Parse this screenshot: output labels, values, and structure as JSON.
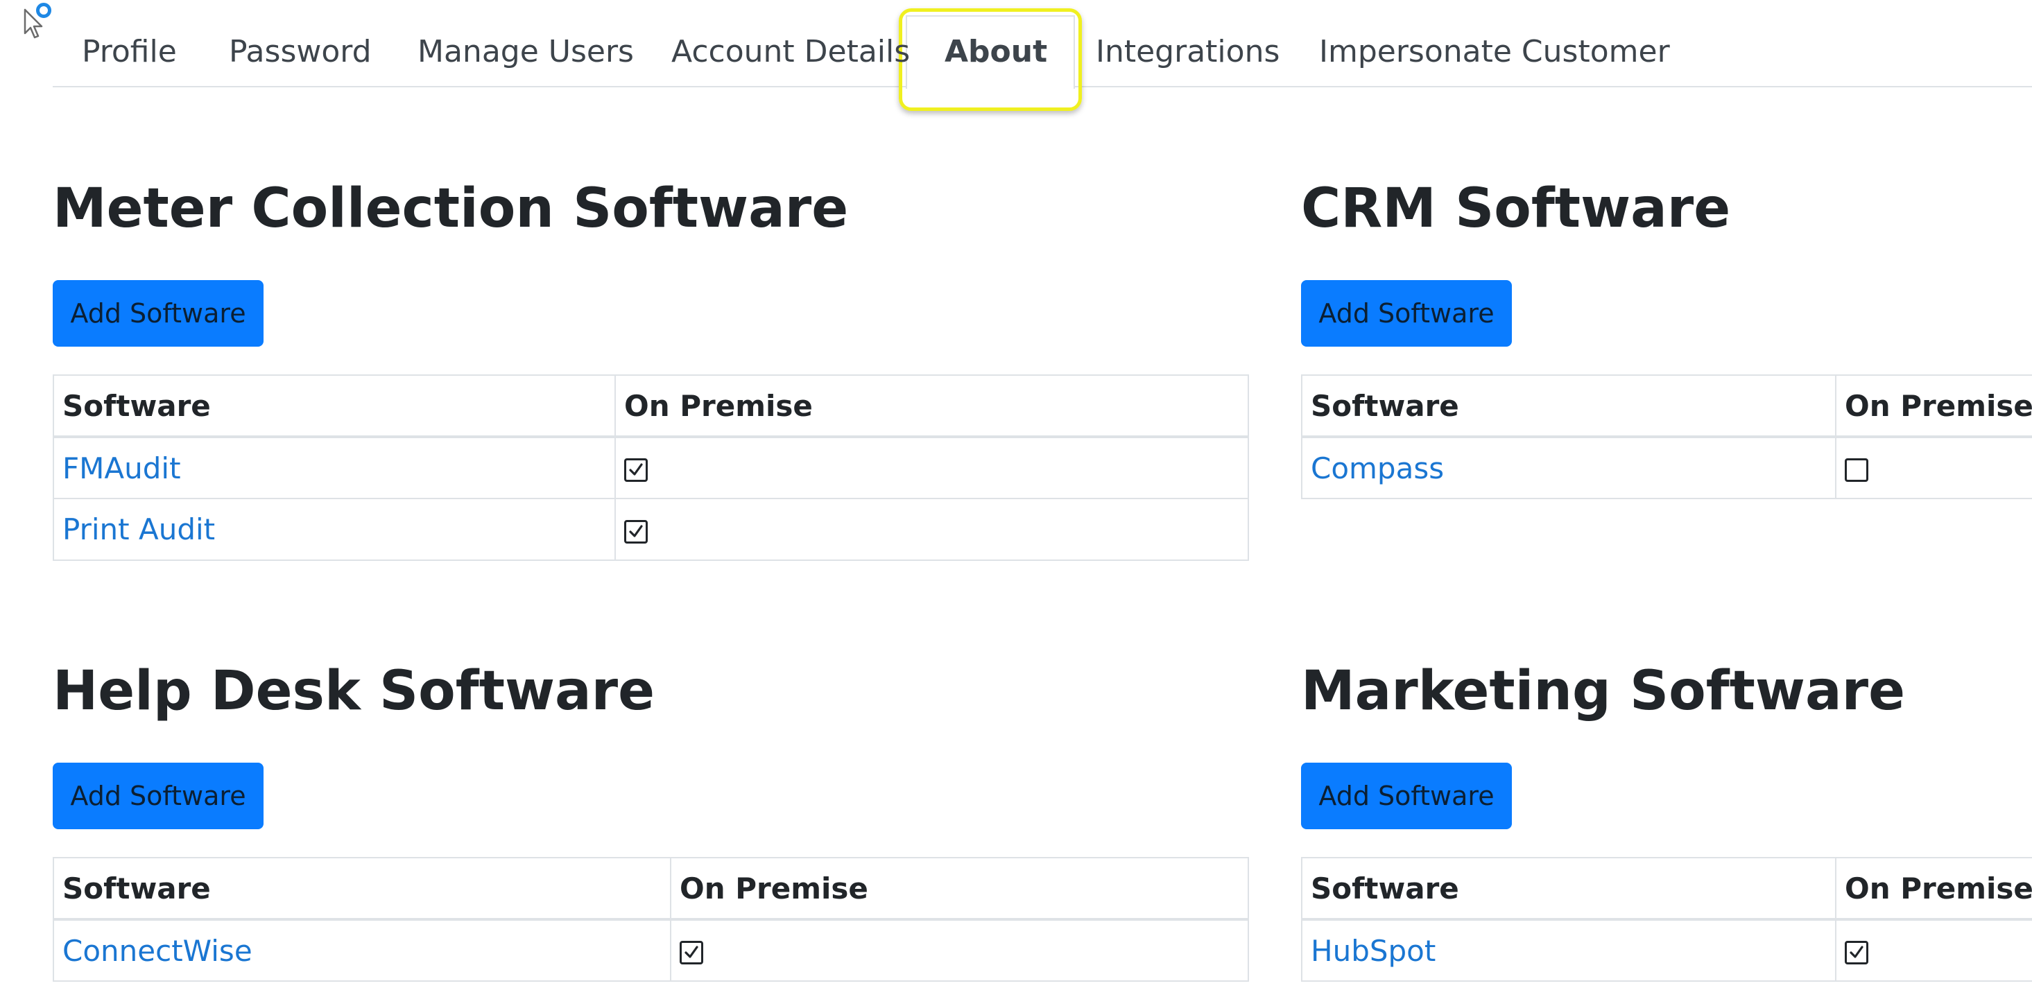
{
  "tabs": [
    {
      "label": "Profile",
      "active": false
    },
    {
      "label": "Password",
      "active": false
    },
    {
      "label": "Manage Users",
      "active": false
    },
    {
      "label": "Account Details",
      "active": false
    },
    {
      "label": "About",
      "active": true
    },
    {
      "label": "Integrations",
      "active": false
    },
    {
      "label": "Impersonate Customer",
      "active": false
    }
  ],
  "colors": {
    "primary_button": "#0a7cff",
    "link": "#1a76d2",
    "highlight": "#f0f020"
  },
  "sections": {
    "meter": {
      "title": "Meter Collection Software",
      "add_label": "Add Software",
      "col_software": "Software",
      "col_on_premise": "On Premise",
      "rows": [
        {
          "name": "FMAudit",
          "on_premise": true
        },
        {
          "name": "Print Audit",
          "on_premise": true
        }
      ]
    },
    "crm": {
      "title": "CRM Software",
      "add_label": "Add Software",
      "col_software": "Software",
      "col_on_premise": "On Premise",
      "rows": [
        {
          "name": "Compass",
          "on_premise": false
        }
      ]
    },
    "helpdesk": {
      "title": "Help Desk Software",
      "add_label": "Add Software",
      "col_software": "Software",
      "col_on_premise": "On Premise",
      "rows": [
        {
          "name": "ConnectWise",
          "on_premise": true
        }
      ]
    },
    "marketing": {
      "title": "Marketing Software",
      "add_label": "Add Software",
      "col_software": "Software",
      "col_on_premise": "On Premise",
      "rows": [
        {
          "name": "HubSpot",
          "on_premise": true
        }
      ]
    }
  }
}
